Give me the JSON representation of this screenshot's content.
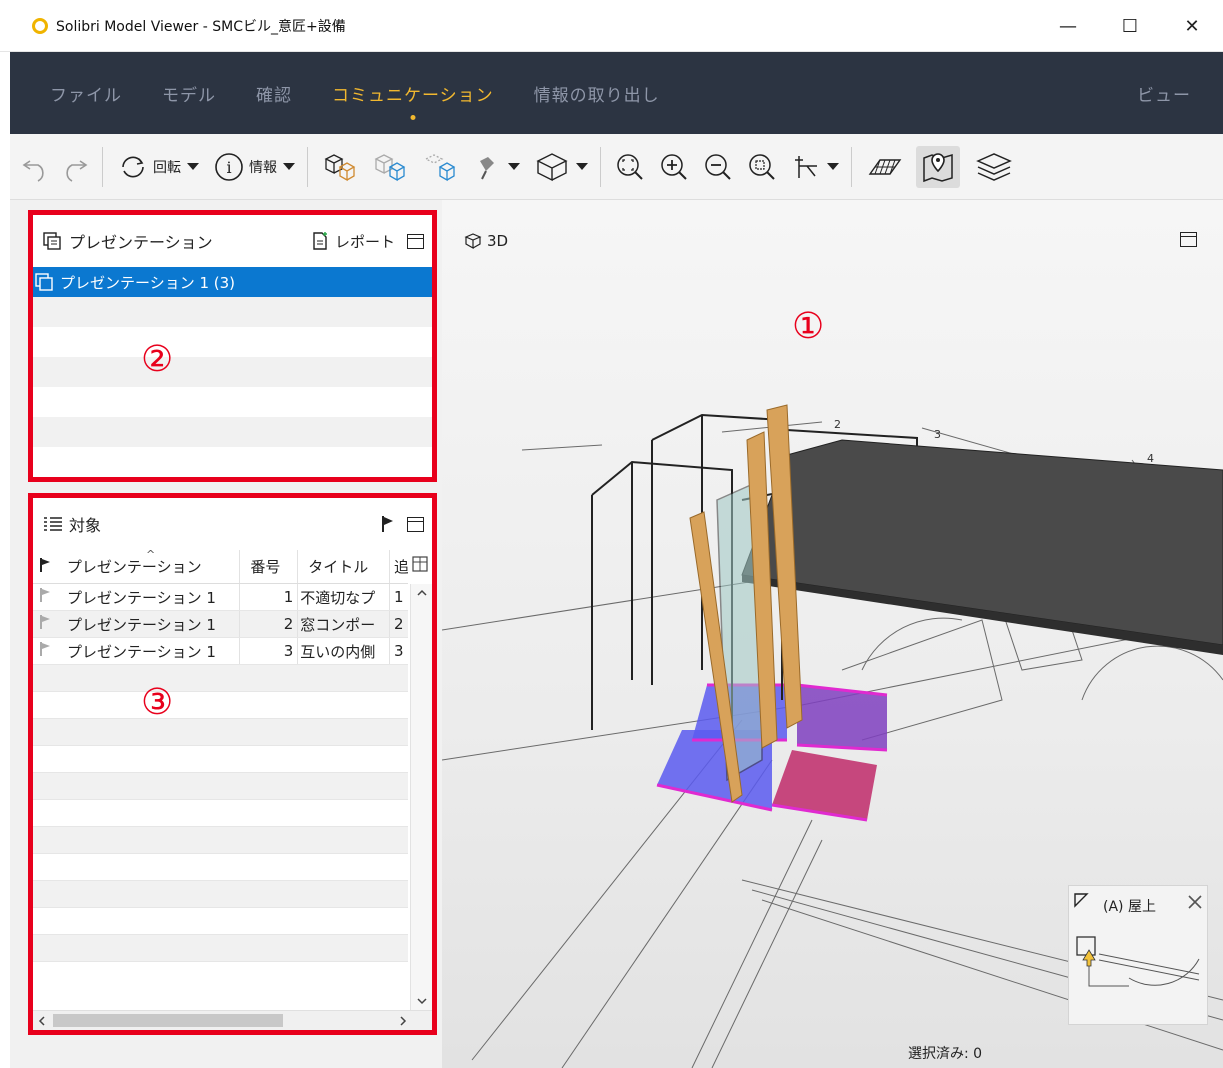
{
  "window": {
    "title": "Solibri Model Viewer - SMCビル_意匠+設備",
    "minimize": "—",
    "maximize": "☐",
    "close": "✕"
  },
  "menu": {
    "items": [
      "ファイル",
      "モデル",
      "確認",
      "コミュニケーション",
      "情報の取り出し"
    ],
    "active_index": 3,
    "right": "ビュー"
  },
  "toolbar": {
    "rotate_label": "回転",
    "info_label": "情報"
  },
  "presentation_panel": {
    "title": "プレゼンテーション",
    "report_label": "レポート",
    "items": [
      "プレゼンテーション 1 (3)"
    ]
  },
  "targets_panel": {
    "title": "対象",
    "columns": [
      "プレゼンテーション",
      "番号",
      "タイトル",
      "追"
    ],
    "rows": [
      {
        "presentation": "プレゼンテーション 1",
        "number": "1",
        "title": "不適切なプ",
        "extra": "1"
      },
      {
        "presentation": "プレゼンテーション 1",
        "number": "2",
        "title": "窓コンポー",
        "extra": "2"
      },
      {
        "presentation": "プレゼンテーション 1",
        "number": "3",
        "title": "互いの内側",
        "extra": "3"
      }
    ]
  },
  "viewport": {
    "label": "3D",
    "minimap_title": "(A) 屋上",
    "status": "選択済み: 0"
  },
  "annotations": {
    "one": "①",
    "two": "②",
    "three": "③"
  },
  "colors": {
    "highlight_red": "#e8001c",
    "menu_bg": "#2c3442",
    "menu_active": "#f2b82f",
    "selection_blue": "#0b78d0"
  }
}
